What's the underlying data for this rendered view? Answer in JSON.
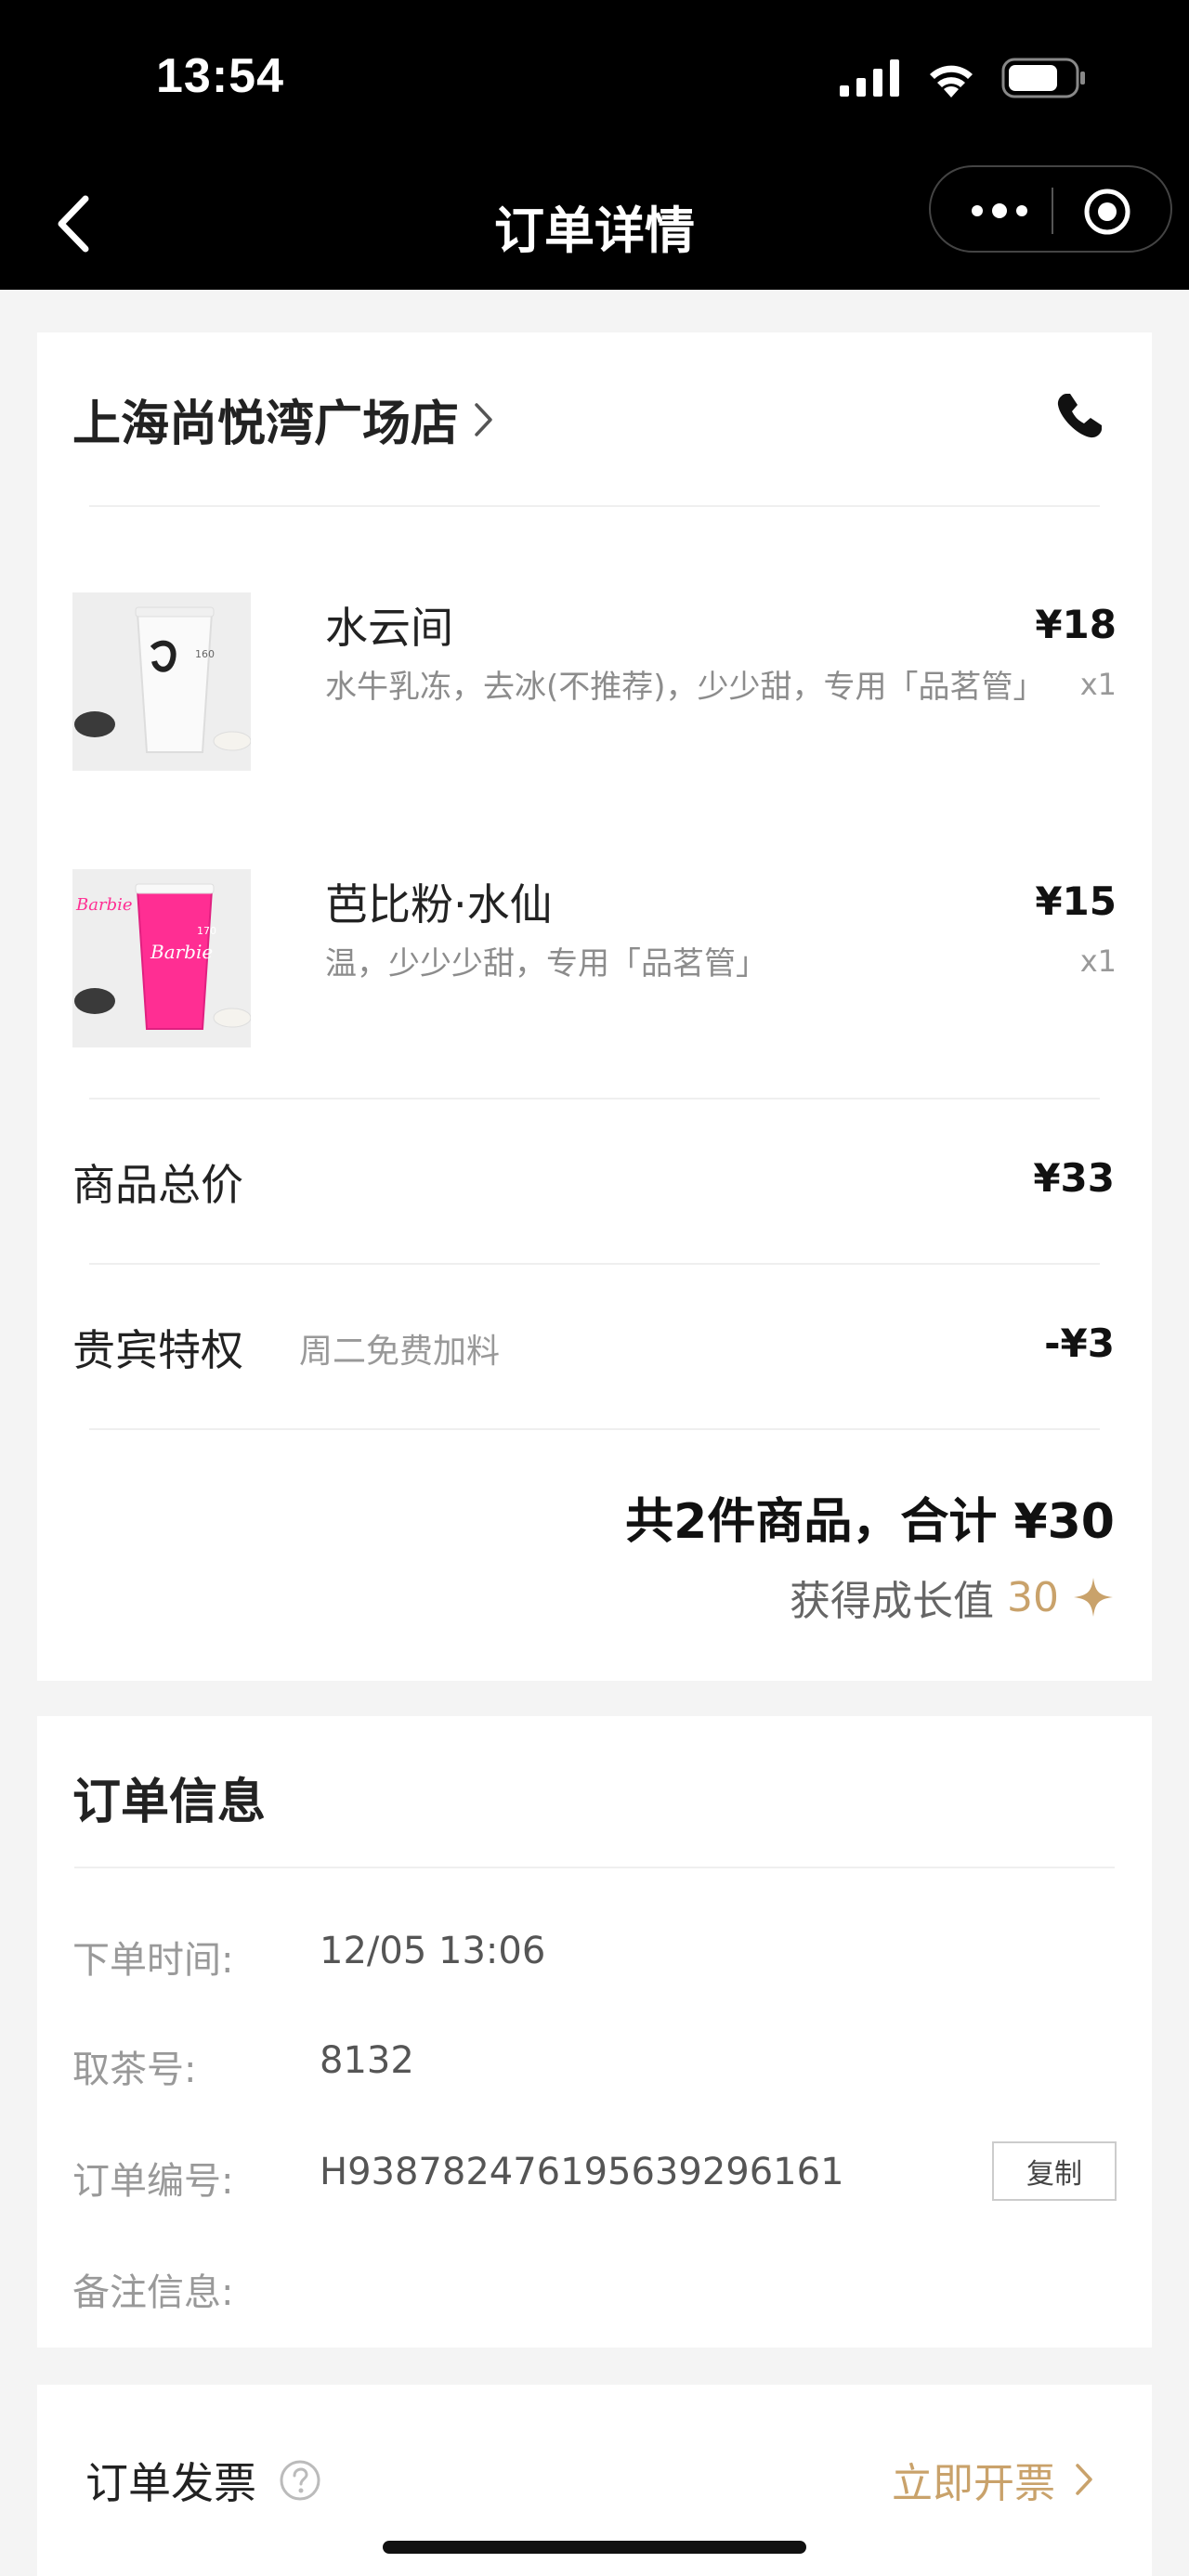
{
  "status_bar": {
    "time": "13:54"
  },
  "nav": {
    "title": "订单详情"
  },
  "store": {
    "name": "上海尚悦湾广场店"
  },
  "items": [
    {
      "name": "水云间",
      "options": "水牛乳冻，去冰(不推荐)，少少甜，专用「品茗管」",
      "price": "¥18",
      "qty": "x1"
    },
    {
      "name": "芭比粉·水仙",
      "options": "温，少少少甜，专用「品茗管」",
      "price": "¥15",
      "qty": "x1"
    }
  ],
  "summary": {
    "subtotal_label": "商品总价",
    "subtotal_value": "¥33",
    "vip_label": "贵宾特权",
    "vip_desc": "周二免费加料",
    "vip_value": "-¥3",
    "total_text": "共2件商品，合计 ¥30",
    "growth_label": "获得成长值",
    "growth_value": "30"
  },
  "order_info": {
    "title": "订单信息",
    "time_label": "下单时间:",
    "time_value": "12/05 13:06",
    "pickup_label": "取茶号:",
    "pickup_value": "8132",
    "order_no_label": "订单编号:",
    "order_no_value": "H93878247619563929616​1",
    "copy_label": "复制",
    "note_label": "备注信息:"
  },
  "invoice": {
    "label": "订单发票",
    "action": "立即开票"
  },
  "colors": {
    "accent": "#c9a26b",
    "barbie_pink": "#ff2e93"
  }
}
